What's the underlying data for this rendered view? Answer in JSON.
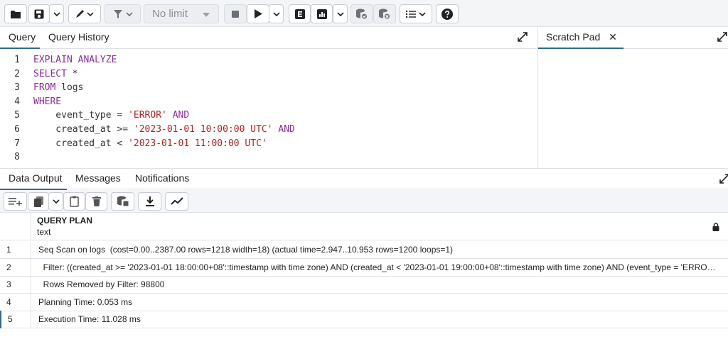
{
  "toolbar": {
    "limit_value": "No limit",
    "icons": [
      "folder-icon",
      "save-icon",
      "pencil-icon",
      "filter-icon",
      "stop-icon",
      "play-icon",
      "explain-icon",
      "explain-analyze-icon",
      "commit-icon",
      "rollback-icon",
      "macros-icon",
      "help-icon"
    ]
  },
  "editor_tabs": {
    "query": "Query",
    "query_history": "Query History"
  },
  "scratch_pad": {
    "label": "Scratch Pad",
    "close": "✕"
  },
  "editor": {
    "lines": [
      {
        "num": "1",
        "tokens": [
          {
            "t": "EXPLAIN ANALYZE",
            "c": "kw"
          }
        ]
      },
      {
        "num": "2",
        "tokens": [
          {
            "t": "SELECT",
            "c": "kw"
          },
          {
            "t": " *",
            "c": ""
          }
        ]
      },
      {
        "num": "3",
        "tokens": [
          {
            "t": "FROM",
            "c": "kw"
          },
          {
            "t": " logs",
            "c": ""
          }
        ]
      },
      {
        "num": "4",
        "tokens": [
          {
            "t": "WHERE",
            "c": "kw"
          }
        ]
      },
      {
        "num": "5",
        "tokens": [
          {
            "t": "    event_type = ",
            "c": ""
          },
          {
            "t": "'ERROR'",
            "c": "str"
          },
          {
            "t": " ",
            "c": ""
          },
          {
            "t": "AND",
            "c": "kw"
          }
        ]
      },
      {
        "num": "6",
        "tokens": [
          {
            "t": "    created_at >= ",
            "c": ""
          },
          {
            "t": "'2023-01-01 10:00:00 UTC'",
            "c": "str"
          },
          {
            "t": " ",
            "c": ""
          },
          {
            "t": "AND",
            "c": "kw"
          }
        ]
      },
      {
        "num": "7",
        "tokens": [
          {
            "t": "    created_at < ",
            "c": ""
          },
          {
            "t": "'2023-01-01 11:00:00 UTC'",
            "c": "str"
          }
        ]
      },
      {
        "num": "8",
        "tokens": []
      }
    ]
  },
  "bottom_tabs": {
    "data_output": "Data Output",
    "messages": "Messages",
    "notifications": "Notifications"
  },
  "grid": {
    "column_title": "QUERY PLAN",
    "column_type": "text",
    "rows": [
      {
        "num": "1",
        "text": "Seq Scan on logs  (cost=0.00..2387.00 rows=1218 width=18) (actual time=2.947..10.953 rows=1200 loops=1)"
      },
      {
        "num": "2",
        "text": "  Filter: ((created_at >= '2023-01-01 18:00:00+08'::timestamp with time zone) AND (created_at < '2023-01-01 19:00:00+08'::timestamp with time zone) AND (event_type = 'ERROR'::text))"
      },
      {
        "num": "3",
        "text": "  Rows Removed by Filter: 98800"
      },
      {
        "num": "4",
        "text": "Planning Time: 0.053 ms"
      },
      {
        "num": "5",
        "text": "Execution Time: 11.028 ms"
      }
    ]
  },
  "colors": {
    "keyword": "#8b2b9b",
    "string": "#b22222",
    "accent": "#326690"
  }
}
